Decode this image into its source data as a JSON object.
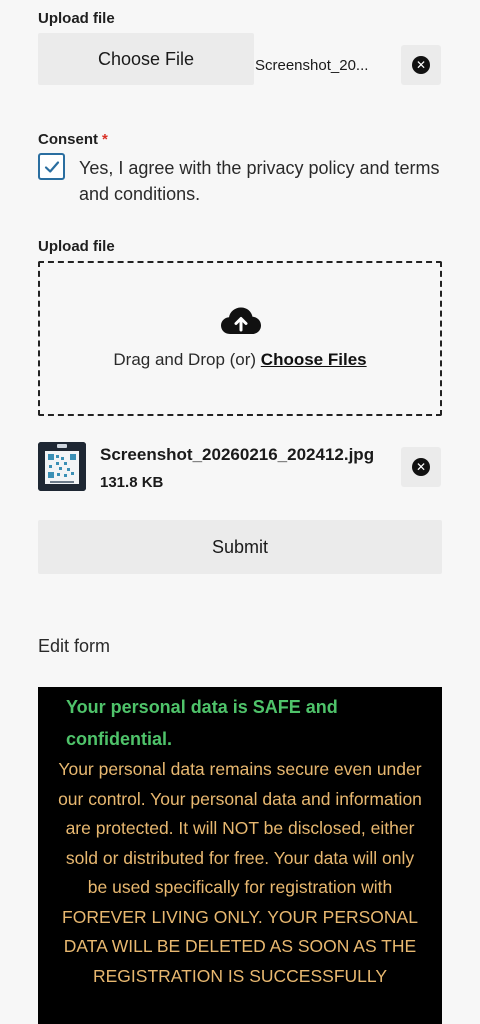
{
  "upload1": {
    "label": "Upload file",
    "choose_button": "Choose File",
    "selected_file": "Screenshot_20..."
  },
  "consent": {
    "label": "Consent",
    "required_mark": "*",
    "checked": true,
    "text": "Yes, I agree with the privacy policy and terms and conditions."
  },
  "upload2": {
    "label": "Upload file",
    "drop_text": "Drag and Drop (or)",
    "choose_link": "Choose Files",
    "file": {
      "name": "Screenshot_20260216_202412.jpg",
      "size": "131.8 KB"
    }
  },
  "submit_label": "Submit",
  "edit_form_label": "Edit form",
  "notice": {
    "heading": "Your personal data is SAFE and confidential.",
    "body": "Your personal data remains secure even under our control. Your personal data and information are protected. It will NOT be disclosed, either sold or distributed for free. Your data will only be used specifically for registration with FOREVER LIVING ONLY. YOUR PERSONAL DATA WILL BE DELETED AS SOON AS THE REGISTRATION IS SUCCESSFULLY",
    "heading_color": "#4fc36a",
    "body_color": "#e8b870"
  },
  "icons": {
    "remove": "close-circle-icon",
    "upload": "cloud-upload-icon",
    "check": "checkmark-icon"
  }
}
